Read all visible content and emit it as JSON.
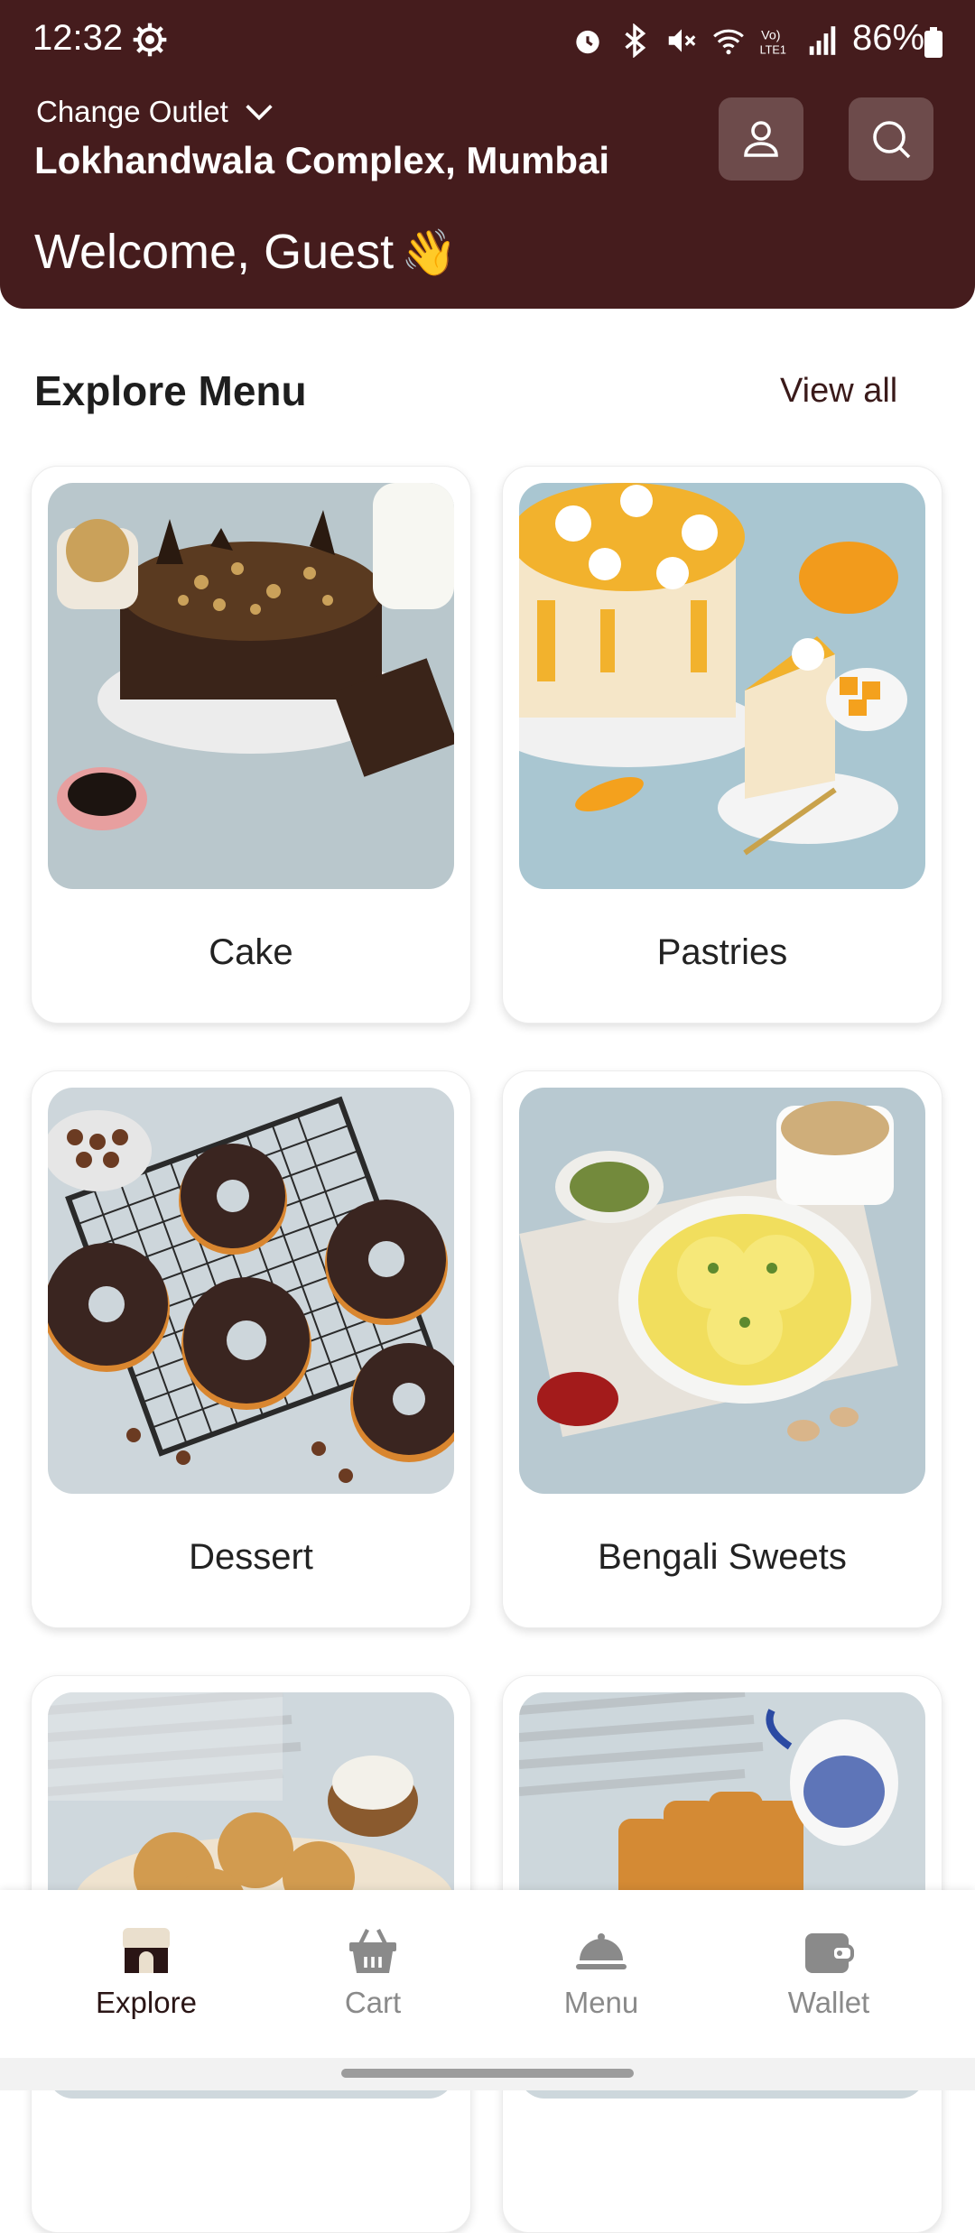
{
  "status_bar": {
    "time": "12:32",
    "battery": "86%"
  },
  "header": {
    "change_outlet_label": "Change Outlet",
    "location": "Lokhandwala Complex, Mumbai",
    "welcome": "Welcome, Guest",
    "welcome_emoji": "👋"
  },
  "explore": {
    "title": "Explore Menu",
    "view_all": "View all"
  },
  "categories": [
    {
      "label": "Cake"
    },
    {
      "label": "Pastries"
    },
    {
      "label": "Dessert"
    },
    {
      "label": "Bengali Sweets"
    },
    {
      "label": ""
    },
    {
      "label": ""
    }
  ],
  "bottom_nav": [
    {
      "label": "Explore",
      "icon": "store-icon",
      "active": true
    },
    {
      "label": "Cart",
      "icon": "basket-icon",
      "active": false
    },
    {
      "label": "Menu",
      "icon": "cloche-icon",
      "active": false
    },
    {
      "label": "Wallet",
      "icon": "wallet-icon",
      "active": false
    }
  ],
  "colors": {
    "brand": "#451c1d",
    "header_button": "#6d4b4b",
    "text_dark": "#1e1e1e"
  }
}
